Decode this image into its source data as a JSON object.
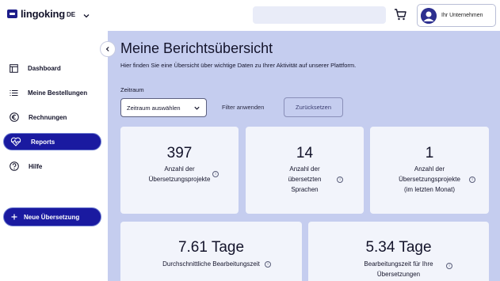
{
  "header": {
    "logo_text": "lingoking",
    "language": "DE",
    "account_label": "Ihr Unternehmen"
  },
  "sidebar": {
    "items": [
      {
        "label": "Dashboard",
        "icon": "layout-icon",
        "active": false
      },
      {
        "label": "Meine Bestellungen",
        "icon": "list-icon",
        "active": false
      },
      {
        "label": "Rechnungen",
        "icon": "euro-icon",
        "active": false
      },
      {
        "label": "Reports",
        "icon": "heart-pulse-icon",
        "active": true
      },
      {
        "label": "Hilfe",
        "icon": "help-icon",
        "active": false
      }
    ],
    "new_button_label": "Neue Übersetzung"
  },
  "main": {
    "title": "Meine Berichtsübersicht",
    "subtitle": "Hier finden Sie eine Übersicht über wichtige Daten zu Ihrer Aktivität auf unserer Plattform.",
    "filter": {
      "period_label": "Zeitraum",
      "period_value": "Zeitraum auswählen",
      "apply_label": "Filter anwenden",
      "reset_label": "Zurücksetzen"
    },
    "stats": [
      {
        "value": "397",
        "label_lines": [
          "Anzahl der",
          "Übersetzungsprojekte"
        ]
      },
      {
        "value": "14",
        "label_lines": [
          "Anzahl der",
          "übersetzten",
          "Sprachen"
        ]
      },
      {
        "value": "1",
        "label_lines": [
          "Anzahl der",
          "Übersetzungsprojekte",
          "(im letzten Monat)"
        ]
      },
      {
        "value": "7.61 Tage",
        "label_lines": [
          "Durchschnittliche Bearbeitungszeit"
        ]
      },
      {
        "value": "5.34 Tage",
        "label_lines": [
          "Bearbeitungszeit für Ihre",
          "Übersetzungen"
        ]
      }
    ]
  },
  "colors": {
    "brand": "#1a1aa0",
    "main_background": "#c5cdef",
    "card_background": "#f2f4fb"
  }
}
